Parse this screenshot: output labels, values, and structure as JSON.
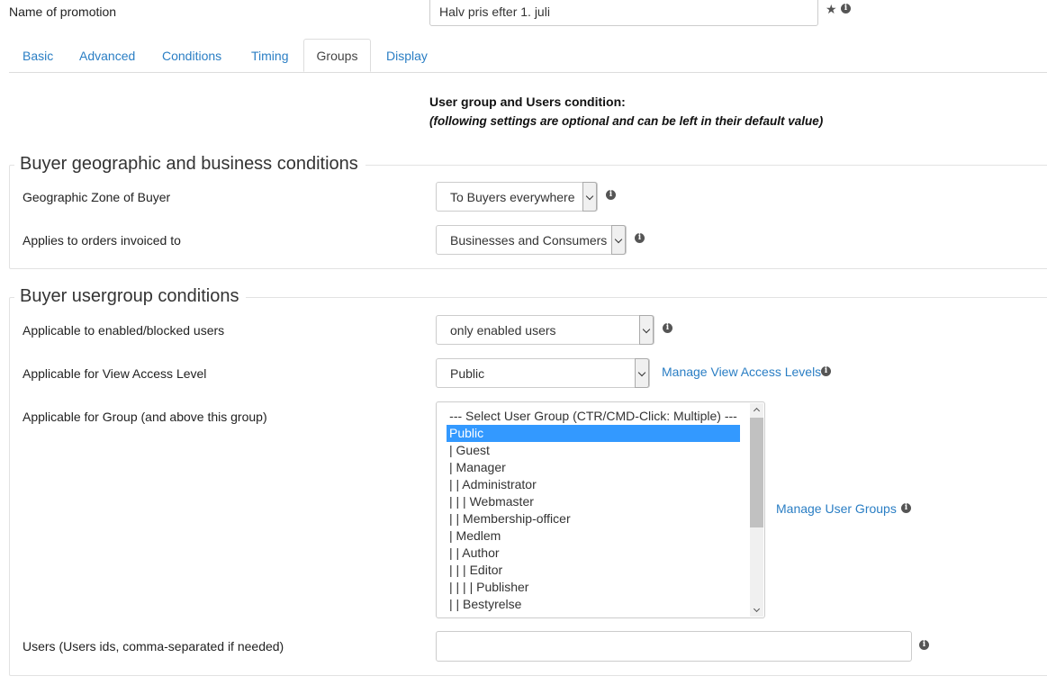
{
  "promotion": {
    "name_label": "Name of promotion",
    "name_value": "Halv pris efter 1. juli"
  },
  "tabs": [
    {
      "label": "Basic"
    },
    {
      "label": "Advanced"
    },
    {
      "label": "Conditions"
    },
    {
      "label": "Timing"
    },
    {
      "label": "Groups",
      "active": true
    },
    {
      "label": "Display"
    }
  ],
  "intro": {
    "title": "User group and Users condition:",
    "subtitle": "(following settings are optional and can be left in their default value)"
  },
  "geo_section": {
    "legend": "Buyer geographic and business conditions",
    "zone_label": "Geographic Zone of Buyer",
    "zone_value": "To Buyers everywhere",
    "invoiced_label": "Applies to orders invoiced to",
    "invoiced_value": "Businesses and Consumers"
  },
  "usergroup_section": {
    "legend": "Buyer usergroup conditions",
    "enabled_label": "Applicable to enabled/blocked users",
    "enabled_value": "only enabled users",
    "access_label": "Applicable for View Access Level",
    "access_value": "Public",
    "access_link": "Manage View Access Levels",
    "group_label": "Applicable for Group (and above this group)",
    "group_link": "Manage User Groups",
    "group_options": [
      "--- Select User Group (CTR/CMD-Click: Multiple) ---",
      "Public",
      "| Guest",
      "| Manager",
      "| | Administrator",
      "| | | Webmaster",
      "| | Membership-officer",
      "| Medlem",
      "| | Author",
      "| | | Editor",
      "| | | | Publisher",
      "| | Bestyrelse"
    ],
    "group_selected_index": 1,
    "users_label": "Users (Users ids, comma-separated if needed)",
    "users_value": ""
  },
  "icons": {
    "star": "star-icon",
    "info": "info-icon",
    "dropdown": "chevron-down-icon"
  }
}
